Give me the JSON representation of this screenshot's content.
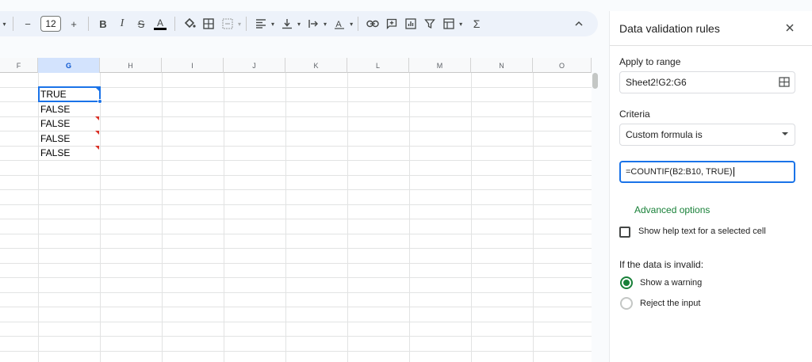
{
  "toolbar": {
    "font_size": "12",
    "expand_icon": "chevron-up-icon"
  },
  "sheet": {
    "columns": [
      "F",
      "G",
      "H",
      "I",
      "J",
      "K",
      "L",
      "M",
      "N",
      "O"
    ],
    "selected_column": "G",
    "cells_G": [
      "TRUE",
      "FALSE",
      "FALSE",
      "FALSE",
      "FALSE"
    ]
  },
  "panel": {
    "title": "Data validation rules",
    "apply_to_range_label": "Apply to range",
    "range_value": "Sheet2!G2:G6",
    "criteria_label": "Criteria",
    "criteria_value": "Custom formula is",
    "formula_value": "=COUNTIF(B2:B10, TRUE)",
    "advanced_options": "Advanced options",
    "help_text_label": "Show help text for a selected cell",
    "invalid_label": "If the data is invalid:",
    "option_warning": "Show a warning",
    "option_reject": "Reject the input"
  },
  "colors": {
    "accent_blue": "#1a73e8",
    "accent_green": "#188038",
    "error_flag": "#d93025"
  }
}
